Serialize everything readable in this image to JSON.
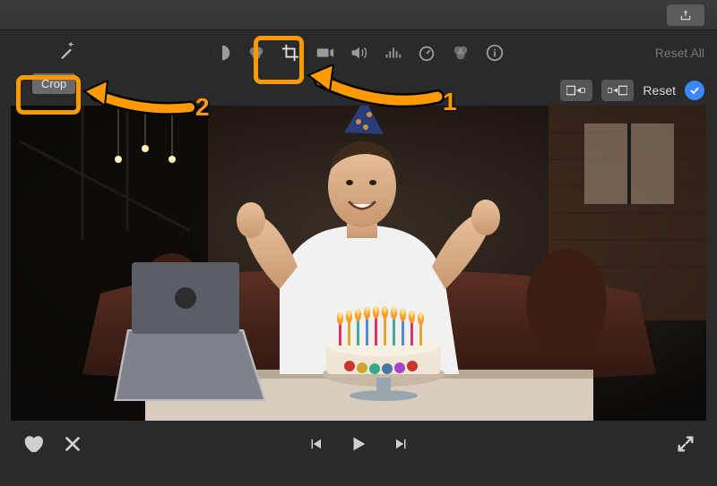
{
  "titlebar": {
    "share_label": "Share"
  },
  "toolbar": {
    "magic_label": "Enhance",
    "reset_all_label": "Reset All",
    "icons": {
      "color_balance": "color-balance",
      "color_correction": "color-correction",
      "crop": "crop",
      "stabilization": "stabilization",
      "volume": "volume",
      "noise": "noise-reduction",
      "speed": "speed",
      "filters": "filters",
      "info": "info"
    }
  },
  "crop_panel": {
    "crop_label": "Crop",
    "kb_start_label": "Ken Burns Start",
    "kb_end_label": "Ken Burns End",
    "reset_label": "Reset",
    "apply_label": "Apply"
  },
  "playback": {
    "fav_label": "Favorite",
    "reject_label": "Reject",
    "prev_label": "Previous",
    "play_label": "Play",
    "next_label": "Next",
    "fullscreen_label": "Full Screen"
  },
  "annotations": {
    "callout_1": "1",
    "callout_2": "2"
  },
  "preview": {
    "description": "Man in white t-shirt celebrating birthday with cake and candles, laptop on table, party hat"
  }
}
